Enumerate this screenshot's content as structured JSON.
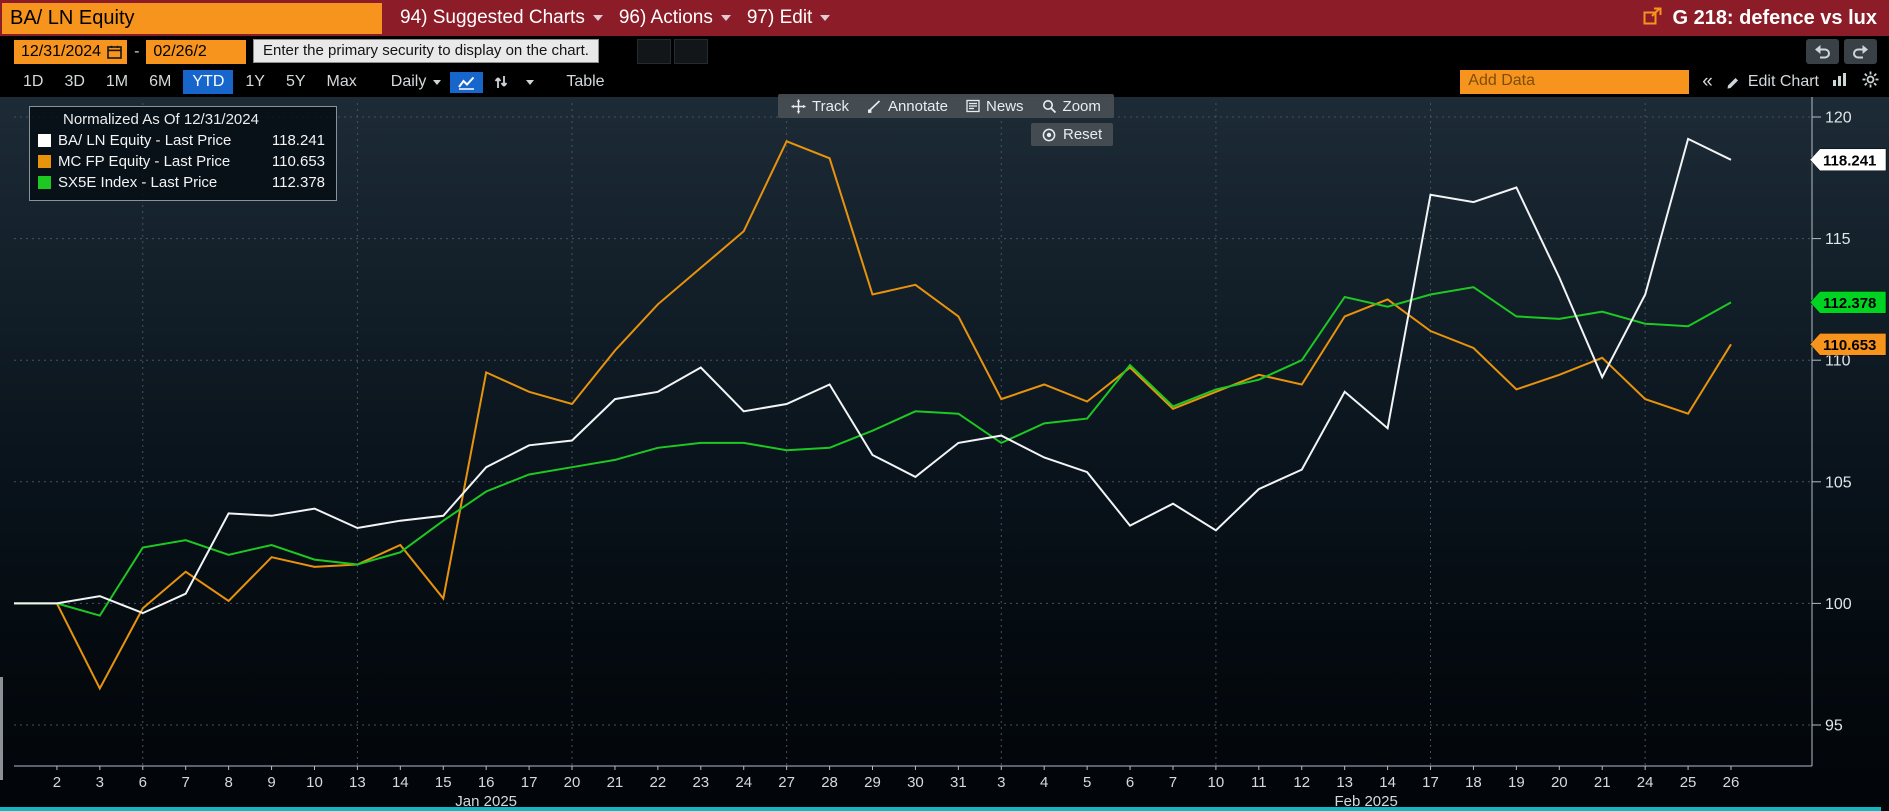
{
  "colors": {
    "amber": "#f7941e",
    "header_red": "#8c1c28",
    "highlight_blue": "#1666cc",
    "teal_strip": "#10b7c0"
  },
  "top_bar": {
    "security_input": "BA/ LN Equity",
    "menus": [
      "94) Suggested Charts",
      "96) Actions",
      "97) Edit"
    ],
    "window_title": "G 218: defence vs lux"
  },
  "date_row": {
    "from": "12/31/2024",
    "separator": "-",
    "to": "02/26/2",
    "tooltip": "Enter the primary security to display on the chart."
  },
  "toolbar": {
    "ranges": [
      "1D",
      "3D",
      "1M",
      "6M",
      "YTD",
      "1Y",
      "5Y",
      "Max"
    ],
    "active_range": "YTD",
    "period": "Daily",
    "table_label": "Table",
    "add_data_placeholder": "Add Data",
    "collapse_label": "«",
    "edit_chart_label": "Edit Chart"
  },
  "overlay": {
    "track": "Track",
    "annotate": "Annotate",
    "news": "News",
    "zoom": "Zoom",
    "reset": "Reset"
  },
  "legend": {
    "title": "Normalized As Of 12/31/2024",
    "entries": [
      {
        "label": "BA/ LN Equity - Last Price",
        "value": "118.241",
        "color": "#ffffff"
      },
      {
        "label": "MC FP Equity - Last Price",
        "value": "110.653",
        "color": "#e8930c"
      },
      {
        "label": "SX5E Index - Last Price",
        "value": "112.378",
        "color": "#1dc823"
      }
    ]
  },
  "chart_data": {
    "type": "line",
    "title": "Normalized As Of 12/31/2024",
    "normalize_date": "12/31/2024",
    "categories": [
      "",
      "2",
      "3",
      "6",
      "7",
      "8",
      "9",
      "10",
      "13",
      "14",
      "15",
      "16",
      "17",
      "20",
      "21",
      "22",
      "23",
      "24",
      "27",
      "28",
      "29",
      "30",
      "31",
      "3",
      "4",
      "5",
      "6",
      "7",
      "10",
      "11",
      "12",
      "13",
      "14",
      "17",
      "18",
      "19",
      "20",
      "21",
      "24",
      "25",
      "26"
    ],
    "month_groups": [
      {
        "label": "Jan 2025",
        "start": 0,
        "end": 22
      },
      {
        "label": "Feb 2025",
        "start": 23,
        "end": 40
      }
    ],
    "series": [
      {
        "name": "BA/ LN Equity - Last Price",
        "color": "#f2f4f5",
        "callout_color": "#ffffff",
        "last_label": "118.241",
        "values": [
          100,
          100.0,
          100.3,
          99.6,
          100.4,
          103.7,
          103.6,
          103.9,
          103.1,
          103.4,
          103.6,
          105.6,
          106.5,
          106.7,
          108.4,
          108.7,
          109.7,
          107.9,
          108.2,
          109.0,
          106.1,
          105.2,
          106.6,
          106.9,
          106.0,
          105.4,
          103.2,
          104.1,
          103.0,
          104.7,
          105.5,
          108.7,
          107.2,
          116.8,
          116.5,
          117.1,
          113.4,
          109.3,
          112.7,
          119.1,
          118.241
        ]
      },
      {
        "name": "MC FP Equity - Last Price",
        "color": "#e8930c",
        "callout_color": "#f7941e",
        "last_label": "110.653",
        "values": [
          100,
          100.0,
          96.5,
          99.8,
          101.3,
          100.1,
          101.9,
          101.5,
          101.6,
          102.4,
          100.2,
          109.5,
          108.7,
          108.2,
          110.4,
          112.3,
          113.8,
          115.3,
          119.0,
          118.3,
          112.7,
          113.1,
          111.8,
          108.4,
          109.0,
          108.3,
          109.7,
          108.0,
          108.7,
          109.4,
          109.0,
          111.8,
          112.5,
          111.2,
          110.5,
          108.8,
          109.4,
          110.1,
          108.4,
          107.8,
          110.653
        ]
      },
      {
        "name": "SX5E Index - Last Price",
        "color": "#1dc823",
        "callout_color": "#00d321",
        "last_label": "112.378",
        "values": [
          100,
          100.0,
          99.5,
          102.3,
          102.6,
          102.0,
          102.4,
          101.8,
          101.6,
          102.1,
          103.4,
          104.6,
          105.3,
          105.6,
          105.9,
          106.4,
          106.6,
          106.6,
          106.3,
          106.4,
          107.1,
          107.9,
          107.8,
          106.6,
          107.4,
          107.6,
          109.8,
          108.1,
          108.8,
          109.2,
          110.0,
          112.6,
          112.2,
          112.7,
          113.0,
          111.8,
          111.7,
          112.0,
          111.5,
          111.4,
          112.378
        ]
      }
    ],
    "yticks": [
      95,
      100,
      105,
      110,
      115,
      120
    ],
    "ylim": [
      93.3,
      120.8
    ],
    "grid": "dashed",
    "vertical_grid_indices": [
      3,
      8,
      13,
      18,
      23,
      28,
      33,
      38
    ],
    "legend_position": "top-left",
    "y_axis_side": "right"
  }
}
